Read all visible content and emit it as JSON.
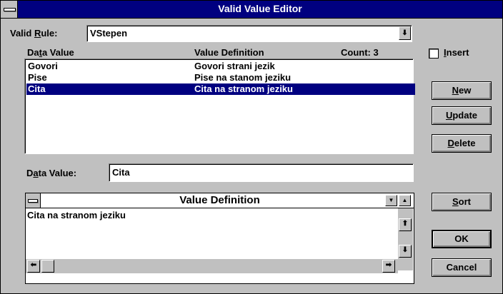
{
  "window": {
    "title": "Valid Value Editor"
  },
  "valid_rule": {
    "label_prefix": "Valid ",
    "label_accel": "R",
    "label_suffix": "ule:",
    "value": "VStepen",
    "arrow": "⬇"
  },
  "list": {
    "header_value_prefix": "Da",
    "header_value_accel": "t",
    "header_value_suffix": "a Value",
    "header_definition": "Value Definition",
    "header_count": "Count: 3",
    "rows": [
      {
        "value": "Govori",
        "definition": "Govori strani jezik"
      },
      {
        "value": "Pise",
        "definition": "Pise na stanom jeziku"
      },
      {
        "value": "Cita",
        "definition": "Cita na stranom jeziku"
      }
    ],
    "selected_index": 2
  },
  "insert": {
    "accel": "I",
    "rest": "nsert",
    "checked": false
  },
  "buttons": {
    "new_accel": "N",
    "new_rest": "ew",
    "update_accel": "U",
    "update_rest": "pdate",
    "delete_accel": "D",
    "delete_rest": "elete",
    "sort_accel": "S",
    "sort_rest": "ort",
    "ok": "OK",
    "cancel": "Cancel"
  },
  "data_value": {
    "label_prefix": "D",
    "label_accel": "a",
    "label_suffix": "ta Value:",
    "value": "Cita"
  },
  "definition_window": {
    "title": "Value Definition",
    "text": "Cita na stranom jeziku"
  },
  "glyphs": {
    "minimize": "▼",
    "maximize": "▲",
    "up": "⬆",
    "down": "⬇",
    "left": "⬅",
    "right": "➡"
  }
}
